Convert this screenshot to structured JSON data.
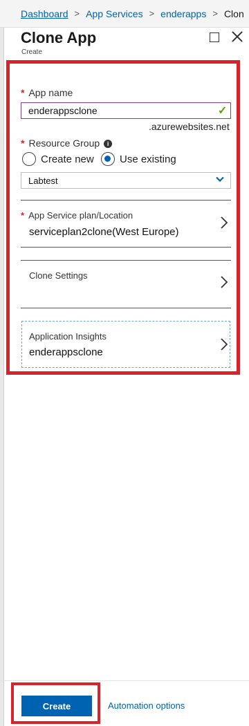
{
  "breadcrumb": {
    "items": [
      "Dashboard",
      "App Services",
      "enderapps",
      "Clon"
    ]
  },
  "blade": {
    "title": "Clone App",
    "subtitle": "Create"
  },
  "form": {
    "app_name": {
      "label": "App name",
      "value": "enderappsclone",
      "suffix": ".azurewebsites.net"
    },
    "resource_group": {
      "label": "Resource Group",
      "options": [
        "Create new",
        "Use existing"
      ],
      "selected": "Use existing",
      "dropdown_value": "Labtest"
    },
    "app_service_plan": {
      "label": "App Service plan/Location",
      "value": "serviceplan2clone(West Europe)"
    },
    "clone_settings": {
      "label": "Clone Settings"
    },
    "application_insights": {
      "label": "Application Insights",
      "value": "enderappsclone"
    }
  },
  "footer": {
    "create_label": "Create",
    "automation_label": "Automation options"
  },
  "colors": {
    "accent": "#0063b1",
    "highlight": "#d8232a",
    "valid": "#57a300"
  }
}
